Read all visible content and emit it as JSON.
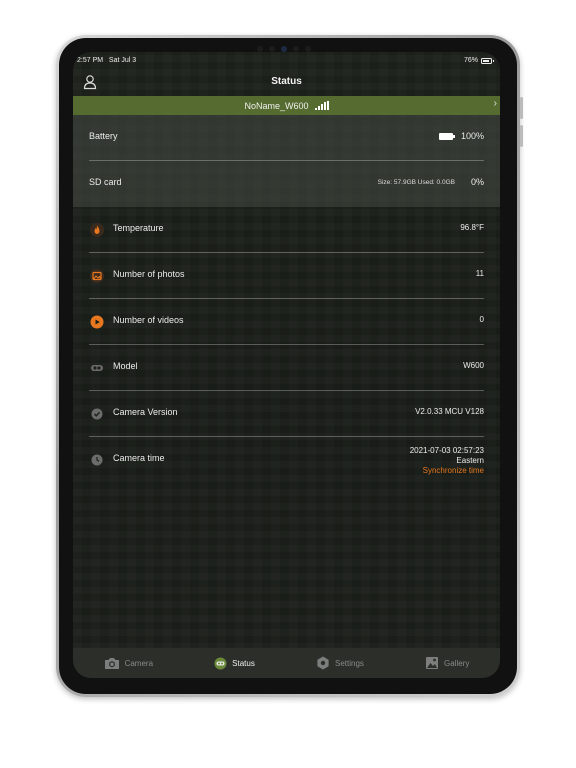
{
  "status_bar": {
    "time": "2:57 PM   Sat Jul 3",
    "battery": "76%"
  },
  "header": {
    "title": "Status"
  },
  "device_bar": {
    "name": "NoName_W600"
  },
  "storage": {
    "battery": {
      "label": "Battery",
      "value": "100%"
    },
    "sd_card": {
      "label": "SD card",
      "size_info": "Size: 57.9GB Used: 0.0GB",
      "value": "0%"
    }
  },
  "rows": [
    {
      "label": "Temperature",
      "value": "96.8°F",
      "icon": "thermometer-icon",
      "color": "#e8781f"
    },
    {
      "label": "Number of photos",
      "value": "11",
      "icon": "photo-icon",
      "color": "#e8781f"
    },
    {
      "label": "Number of videos",
      "value": "0",
      "icon": "video-icon",
      "color": "#e8781f"
    },
    {
      "label": "Model",
      "value": "W600",
      "icon": "model-icon",
      "color": "#6b6b6b"
    },
    {
      "label": "Camera Version",
      "value": "V2.0.33 MCU V128",
      "icon": "version-icon",
      "color": "#6b6b6b"
    },
    {
      "label": "Camera time",
      "icon": "clock-icon",
      "color": "#6b6b6b"
    }
  ],
  "camera_time": {
    "datetime": "2021-07-03 02:57:23",
    "timezone": "Eastern",
    "sync_label": "Synchronize time"
  },
  "tabs": [
    {
      "label": "Camera",
      "icon": "camera-icon",
      "active": false
    },
    {
      "label": "Status",
      "icon": "status-icon",
      "active": true
    },
    {
      "label": "Settings",
      "icon": "settings-icon",
      "active": false
    },
    {
      "label": "Gallery",
      "icon": "gallery-icon",
      "active": false
    }
  ],
  "colors": {
    "accent_orange": "#e8781f",
    "device_bar_green": "#566b2f",
    "background": "#1b1f1a"
  }
}
